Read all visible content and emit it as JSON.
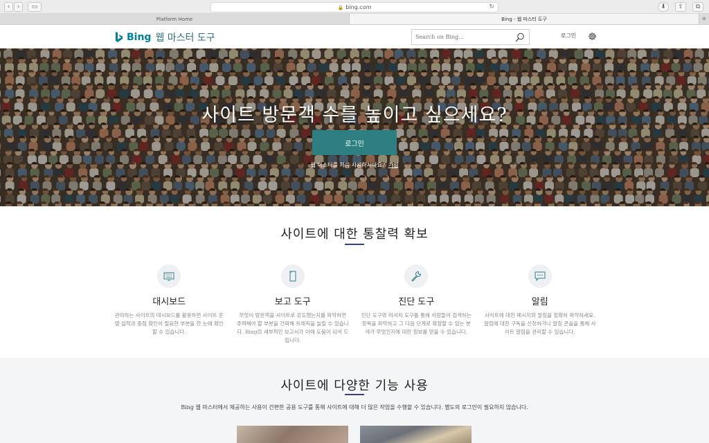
{
  "browser": {
    "address": "bing.com",
    "tabs": [
      "Platform Home",
      "Bing - 웹 마스터 도구"
    ]
  },
  "header": {
    "logo_text": "Bing",
    "logo_sub": "웹 마스터 도구",
    "search_placeholder": "Search on Bing...",
    "signin_label": "로그인"
  },
  "hero": {
    "title": "사이트 방문객 수를 높이고 싶으세요?",
    "button_label": "로그인",
    "note": "웹 마스터를 처음 사용하시나요?",
    "note_link": "가입"
  },
  "insights": {
    "title": "사이트에 대한 통찰력 확보",
    "features": [
      {
        "icon": "dashboard-icon",
        "title": "대시보드",
        "desc": "관리하는 사이트의 대시보드를 활용하면 사이트 운영 실적과 중점 확인이 필요한 부분을 한 눈에 확인할 수 있습니다."
      },
      {
        "icon": "report-icon",
        "title": "보고 도구",
        "desc": "무엇이 방문객을 사이트로 유도했는지를 파악하면 주력해야 할 부분을 간파해 트래픽을 늘릴 수 있습니다. Bing의 세부적인 보고서가 이에 도움이 되어 드립니다."
      },
      {
        "icon": "wrench-icon",
        "title": "진단 도구",
        "desc": "진단 도구와 리서치 도구를 통해 사람들이 검색하는 항목을 파악하고 그 다음 단계로 확장할 수 있는 분야가 무엇인지에 대한 정보를 얻을 수 있습니다."
      },
      {
        "icon": "chat-icon",
        "title": "알림",
        "desc": "사이트에 대한 메시지와 알림을 정확히 파악하세요. 알림에 대한 구독을 신청하거나 알림 콘솔을 통해 사이트 알림을 관리할 수 있습니다."
      }
    ]
  },
  "more": {
    "title": "사이트에 다양한 기능 사용",
    "desc": "Bing 웹 마스터에서 제공하는 사용이 간편한 공용 도구를 통해 사이트에 대해 더 많은 작업을 수행할 수 있습니다. 별도의 로그인이 필요하지 않습니다."
  },
  "colors": {
    "accent": "#2d7f82",
    "brand": "#00809d",
    "underline": "#3a3f7a"
  }
}
